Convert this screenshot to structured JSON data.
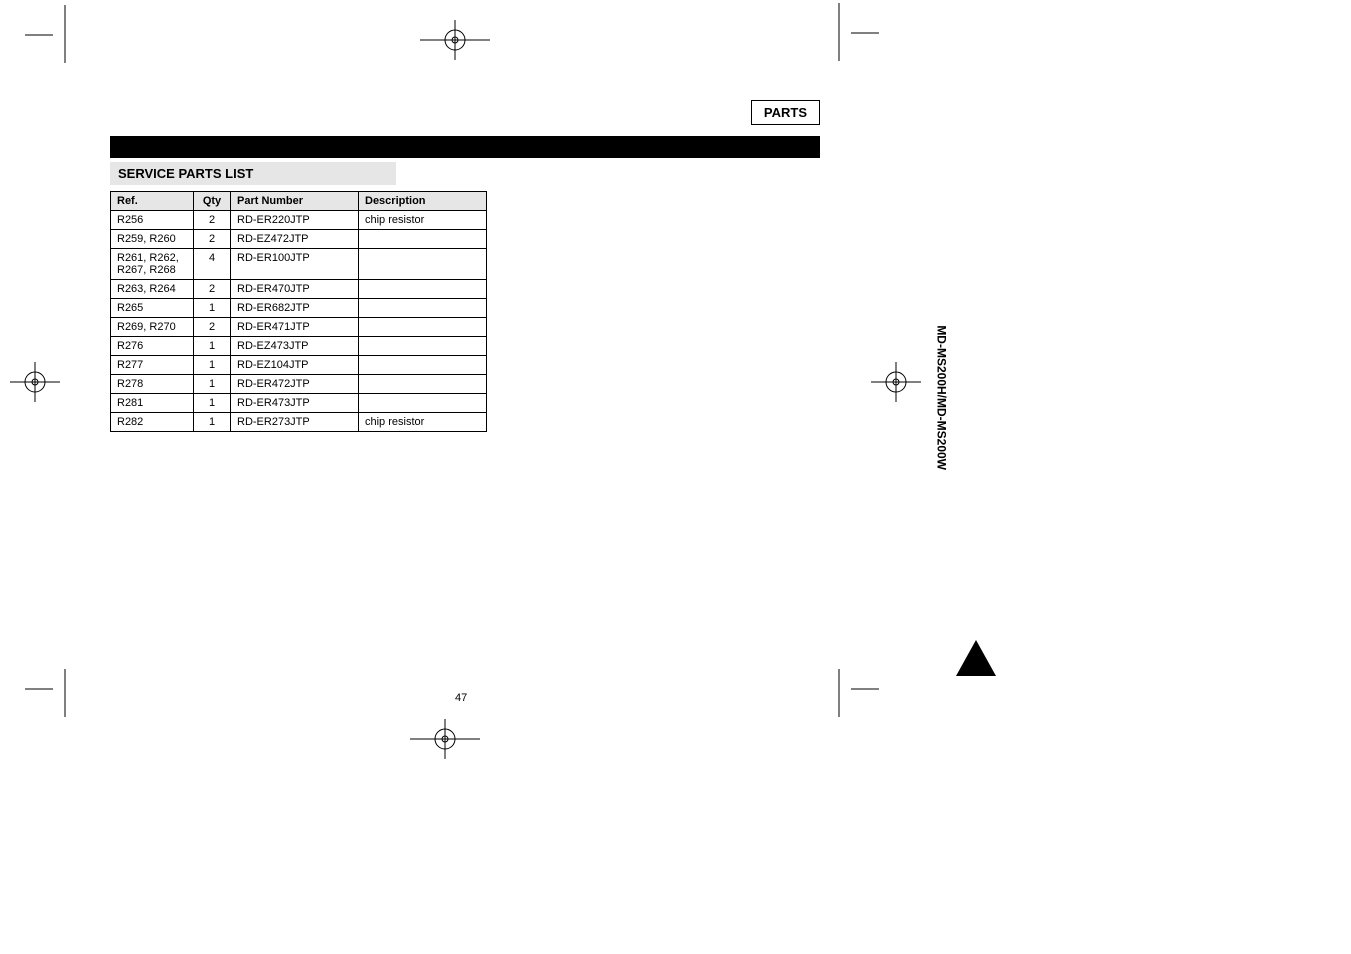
{
  "tab_label": "PARTS",
  "section_title": "SERVICE PARTS LIST",
  "columns": {
    "ref": "Ref.",
    "qty": "Qty",
    "part": "Part Number",
    "desc": "Description"
  },
  "rows": [
    {
      "ref": "R256",
      "qty": "2",
      "part": "RD-ER220JTP",
      "desc": "chip resistor"
    },
    {
      "ref": "R259, R260",
      "qty": "2",
      "part": "RD-EZ472JTP",
      "desc": ""
    },
    {
      "ref": "R261, R262, R267, R268",
      "qty": "4",
      "part": "RD-ER100JTP",
      "desc": ""
    },
    {
      "ref": "R263, R264",
      "qty": "2",
      "part": "RD-ER470JTP",
      "desc": ""
    },
    {
      "ref": "R265",
      "qty": "1",
      "part": "RD-ER682JTP",
      "desc": ""
    },
    {
      "ref": "R269, R270",
      "qty": "2",
      "part": "RD-ER471JTP",
      "desc": ""
    },
    {
      "ref": "R276",
      "qty": "1",
      "part": "RD-EZ473JTP",
      "desc": ""
    },
    {
      "ref": "R277",
      "qty": "1",
      "part": "RD-EZ104JTP",
      "desc": ""
    },
    {
      "ref": "R278",
      "qty": "1",
      "part": "RD-ER472JTP",
      "desc": ""
    },
    {
      "ref": "R281",
      "qty": "1",
      "part": "RD-ER473JTP",
      "desc": ""
    },
    {
      "ref": "R282",
      "qty": "1",
      "part": "RD-ER273JTP",
      "desc": "chip resistor"
    }
  ],
  "spine_text": "MD-MS200H/MD-MS200W",
  "page_number": "47"
}
